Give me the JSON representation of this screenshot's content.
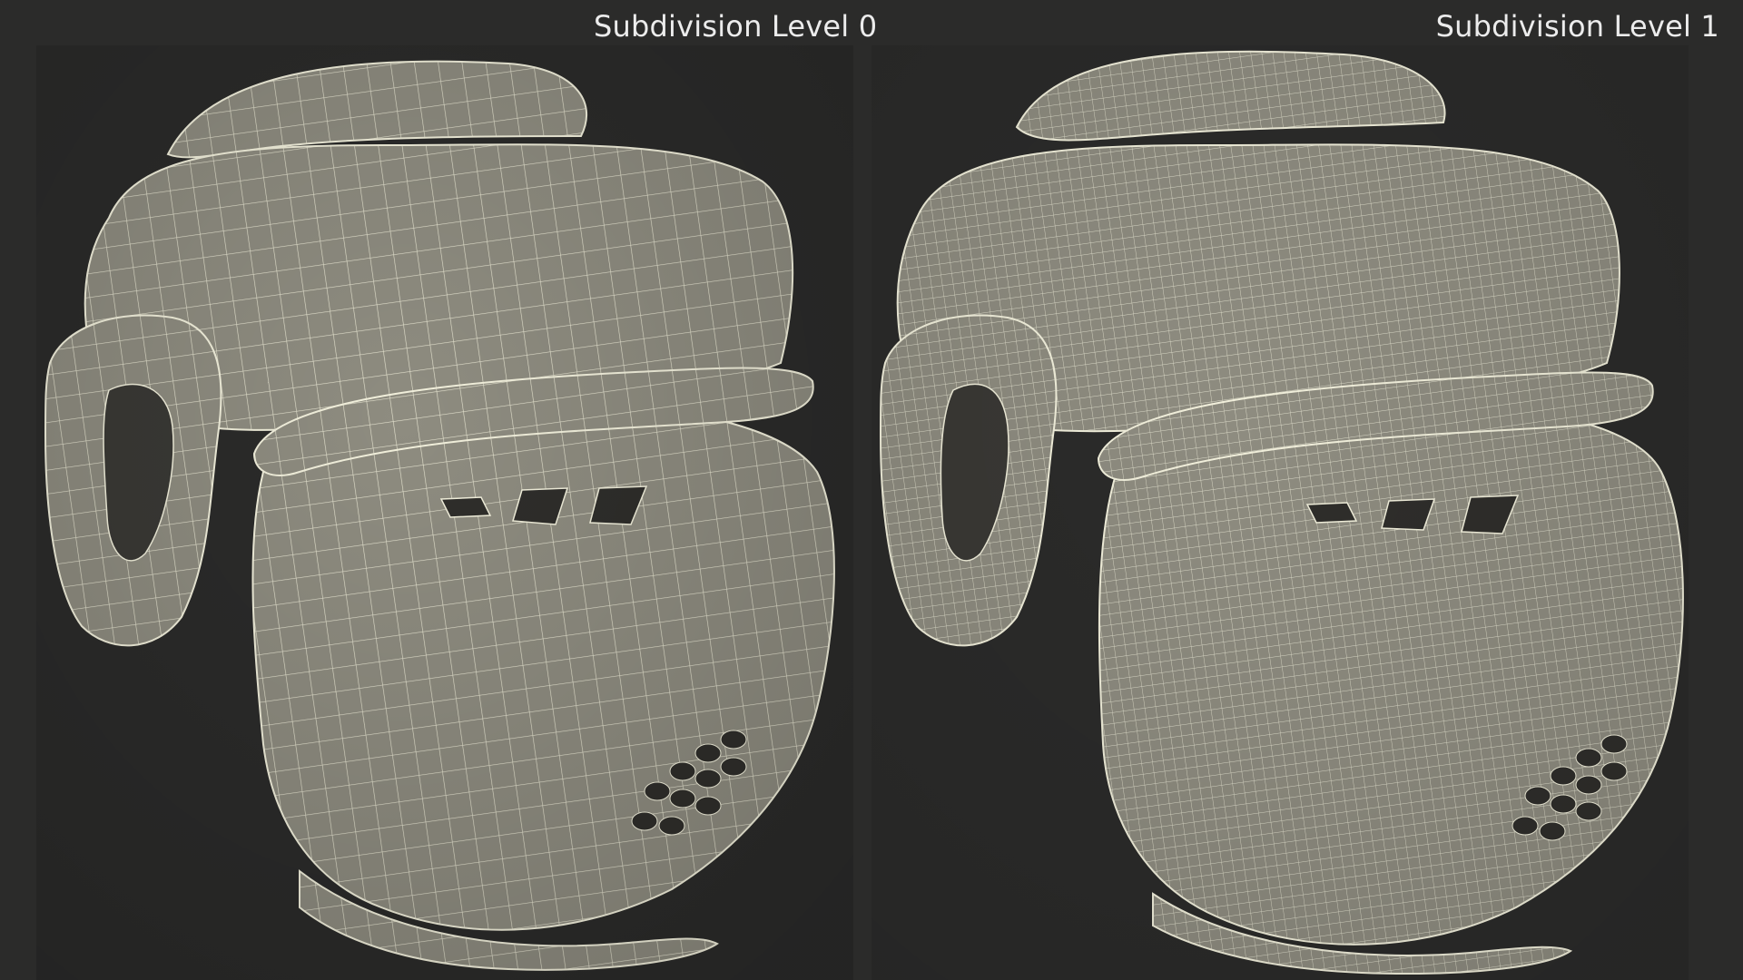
{
  "labels": {
    "left": "Subdivision Level 0",
    "right": "Subdivision Level 1"
  },
  "colors": {
    "background": "#2b2b2a",
    "shell": "#8e8c80",
    "shell_dark": "#6f6d63",
    "wire": "#f2f0dc",
    "label_text": "#ececec"
  }
}
